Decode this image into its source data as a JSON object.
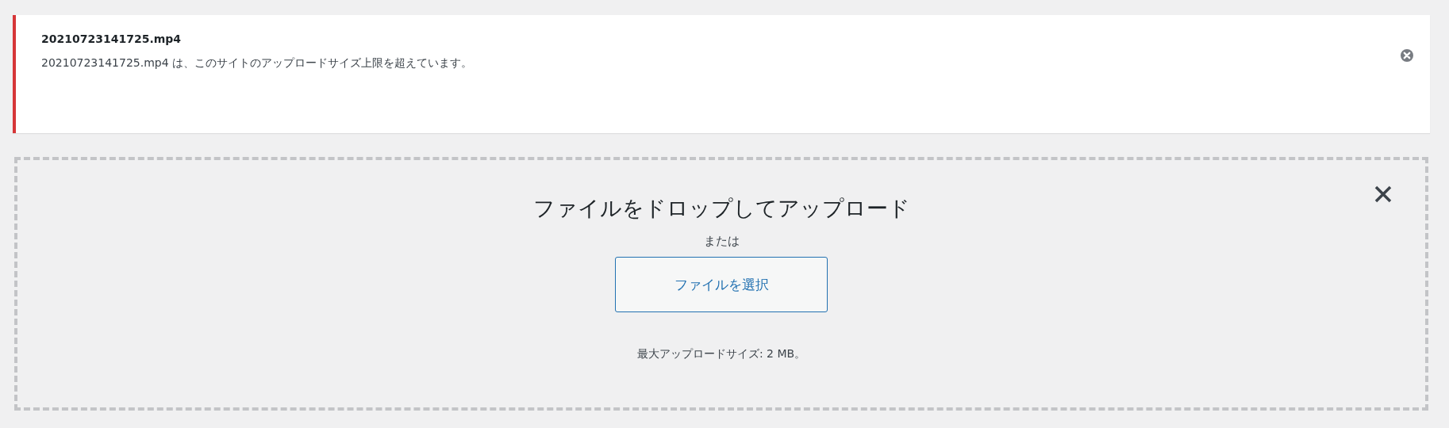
{
  "notice": {
    "title": "20210723141725.mp4",
    "message": "20210723141725.mp4 は、このサイトのアップロードサイズ上限を超えています。"
  },
  "dropzone": {
    "heading": "ファイルをドロップしてアップロード",
    "or": "または",
    "button": "ファイルを選択",
    "max_size": "最大アップロードサイズ: 2 MB。"
  }
}
